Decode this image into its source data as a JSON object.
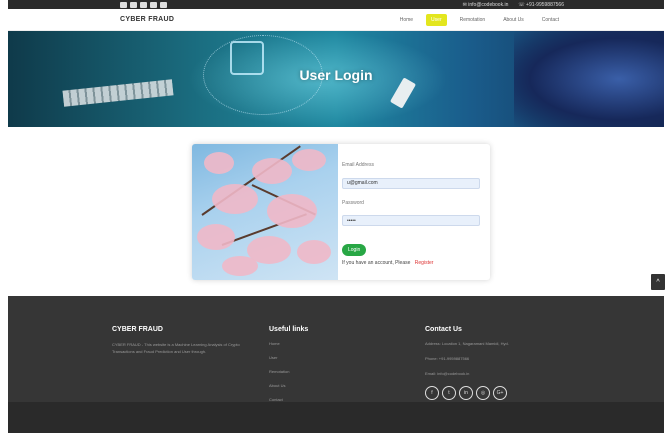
{
  "topbar": {
    "social_icons": [
      "facebook-icon",
      "twitter-icon",
      "linkedin-icon",
      "instagram-icon",
      "google-plus-icon"
    ],
    "email": "info@codebook.in",
    "phone": "+91-9959887566"
  },
  "navbar": {
    "brand": "CYBER FRAUD",
    "links": [
      "Home",
      "User",
      "Remotation",
      "About Us",
      "Contact"
    ],
    "active_index": 1
  },
  "hero": {
    "title": "User Login"
  },
  "login": {
    "email_label": "Email Address",
    "email_value": "u@gmail.com",
    "password_label": "Password",
    "password_value": "•••••",
    "button_label": "Login",
    "register_prompt": "If you have an account, Please",
    "register_link": "Register"
  },
  "footer": {
    "brand": "CYBER FRAUD",
    "description": "CYBER FRAUD - This website is a Machine Learning Analysis of Crypto Transactions and Fraud Prediction and User through.",
    "useful_title": "Useful links",
    "useful_links": [
      "Home",
      "User",
      "Remotation",
      "About Us",
      "Contact"
    ],
    "contact_title": "Contact Us",
    "address": "Address: Location 1, Nagaramani Mamidi, Hyd.",
    "phone": "Phone: +91-9959887566",
    "email": "Email: info@codebook.in",
    "social_icons": [
      "facebook-icon",
      "twitter-icon",
      "linkedin-icon",
      "instagram-icon",
      "google-plus-icon"
    ]
  },
  "scrolltop": {
    "glyph": "^"
  },
  "colors": {
    "accent": "#e3e61e",
    "success": "#28a745",
    "footer_bg": "#363636",
    "link_red": "#d33333"
  }
}
